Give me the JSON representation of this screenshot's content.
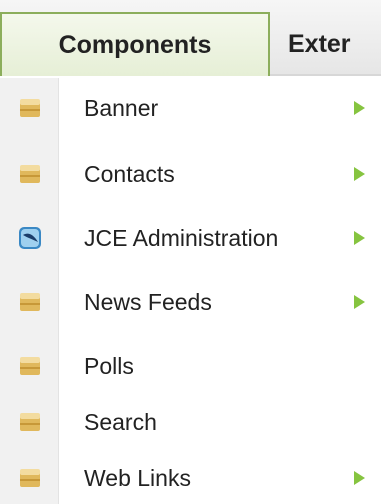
{
  "menubar": {
    "tabs": [
      {
        "label": "Components",
        "active": true
      },
      {
        "label": "Exter",
        "active": false
      }
    ]
  },
  "submenu": {
    "items": [
      {
        "label": "Banner",
        "icon": "folder-icon",
        "has_submenu": true
      },
      {
        "label": "Contacts",
        "icon": "folder-icon",
        "has_submenu": true
      },
      {
        "label": "JCE Administration",
        "icon": "jce-feather-icon",
        "has_submenu": true
      },
      {
        "label": "News Feeds",
        "icon": "folder-icon",
        "has_submenu": true
      },
      {
        "label": "Polls",
        "icon": "folder-icon",
        "has_submenu": false
      },
      {
        "label": "Search",
        "icon": "folder-icon",
        "has_submenu": false
      },
      {
        "label": "Web Links",
        "icon": "folder-icon",
        "has_submenu": true
      }
    ]
  },
  "colors": {
    "accent_green": "#86c440",
    "tab_border": "#8cae5c"
  }
}
